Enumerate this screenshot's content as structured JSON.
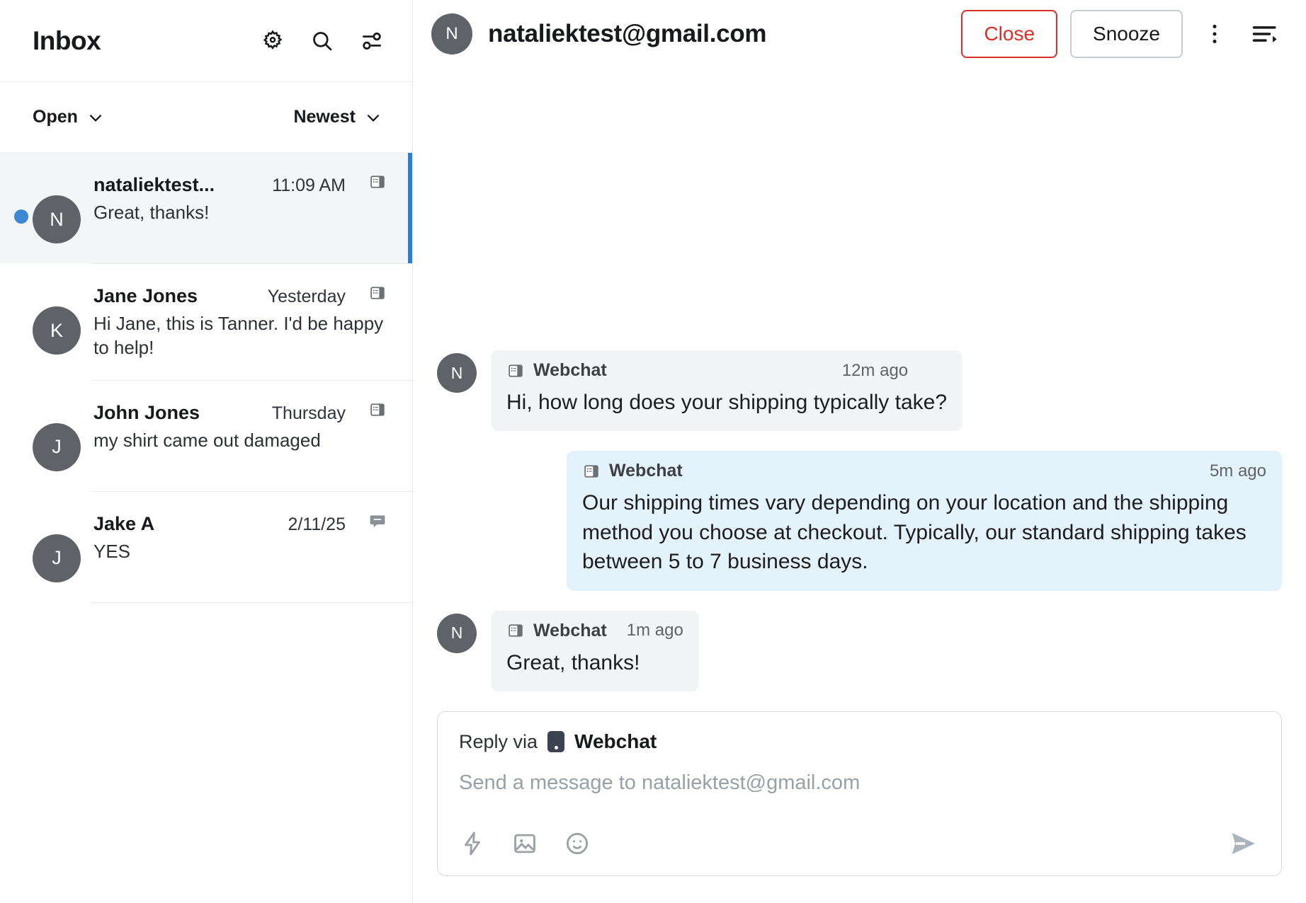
{
  "inbox": {
    "title": "Inbox",
    "icons": {
      "settings": "gear-icon",
      "search": "search-icon",
      "filters": "filter-sliders-icon"
    },
    "filters": {
      "status": "Open",
      "sort": "Newest"
    },
    "conversations": [
      {
        "name": "nataliektest...",
        "time": "11:09 AM",
        "preview": "Great, thanks!",
        "avatar_letter": "N",
        "channel": "webchat-icon",
        "unread": true,
        "selected": true
      },
      {
        "name": "Jane Jones",
        "time": "Yesterday",
        "preview": "Hi Jane, this is Tanner. I'd be happy to help!",
        "avatar_letter": "K",
        "channel": "webchat-icon",
        "unread": false,
        "selected": false
      },
      {
        "name": "John Jones",
        "time": "Thursday",
        "preview": "my shirt came out damaged",
        "avatar_letter": "J",
        "channel": "webchat-icon",
        "unread": false,
        "selected": false
      },
      {
        "name": "Jake A",
        "time": "2/11/25",
        "preview": "YES",
        "avatar_letter": "J",
        "channel": "sms-bubble-icon",
        "unread": false,
        "selected": false
      }
    ]
  },
  "conversation": {
    "contact": "nataliektest@gmail.com",
    "avatar_letter": "N",
    "actions": {
      "close": "Close",
      "snooze": "Snooze",
      "more": "more-vertical-icon",
      "details": "thread-details-icon"
    },
    "messages": [
      {
        "direction": "in",
        "avatar_letter": "N",
        "channel": "Webchat",
        "time": "12m ago",
        "text": "Hi, how long does your shipping typically take?"
      },
      {
        "direction": "out",
        "channel": "Webchat",
        "time": "5m ago",
        "text": "Our shipping times vary depending on your location and the shipping method you choose at checkout. Typically, our standard shipping takes between 5 to 7 business days."
      },
      {
        "direction": "in",
        "avatar_letter": "N",
        "channel": "Webchat",
        "time": "1m ago",
        "text": "Great, thanks!"
      }
    ]
  },
  "composer": {
    "reply_via_label": "Reply via",
    "reply_channel": "Webchat",
    "placeholder": "Send a message to nataliektest@gmail.com",
    "value": "",
    "tools": [
      "lightning-bolt-icon",
      "image-icon",
      "emoji-icon"
    ],
    "send": "send-icon"
  },
  "colors": {
    "accent_blue": "#3b87d4",
    "close_red": "#d93025",
    "outbound_bubble": "#e4f3fb",
    "inbound_bubble": "#f3f4f6",
    "selected_row": "#f3f5f7"
  }
}
